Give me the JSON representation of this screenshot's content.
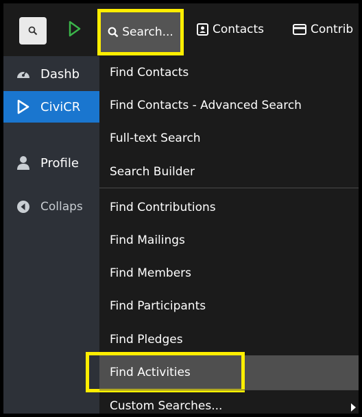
{
  "toolbar": {
    "search_label": "Search...",
    "contacts_label": "Contacts",
    "contributions_label": "Contrib"
  },
  "sidebar": {
    "items": [
      {
        "label": "Dashb",
        "icon": "dashboard-icon"
      },
      {
        "label": "CiviCR",
        "icon": "civicrm-logo-icon"
      },
      {
        "label": "Profile",
        "icon": "user-icon"
      },
      {
        "label": "Collaps",
        "icon": "collapse-icon"
      }
    ]
  },
  "dropdown": {
    "items": [
      "Find Contacts",
      "Find Contacts - Advanced Search",
      "Full-text Search",
      "Search Builder",
      "Find Contributions",
      "Find Mailings",
      "Find Members",
      "Find Participants",
      "Find Pledges",
      "Find Activities",
      "Custom Searches..."
    ],
    "highlighted_index": 9
  },
  "colors": {
    "highlight_border": "#ffee00",
    "active_sidebar": "#1a76cf",
    "civicrm_green": "#3bb54a"
  }
}
